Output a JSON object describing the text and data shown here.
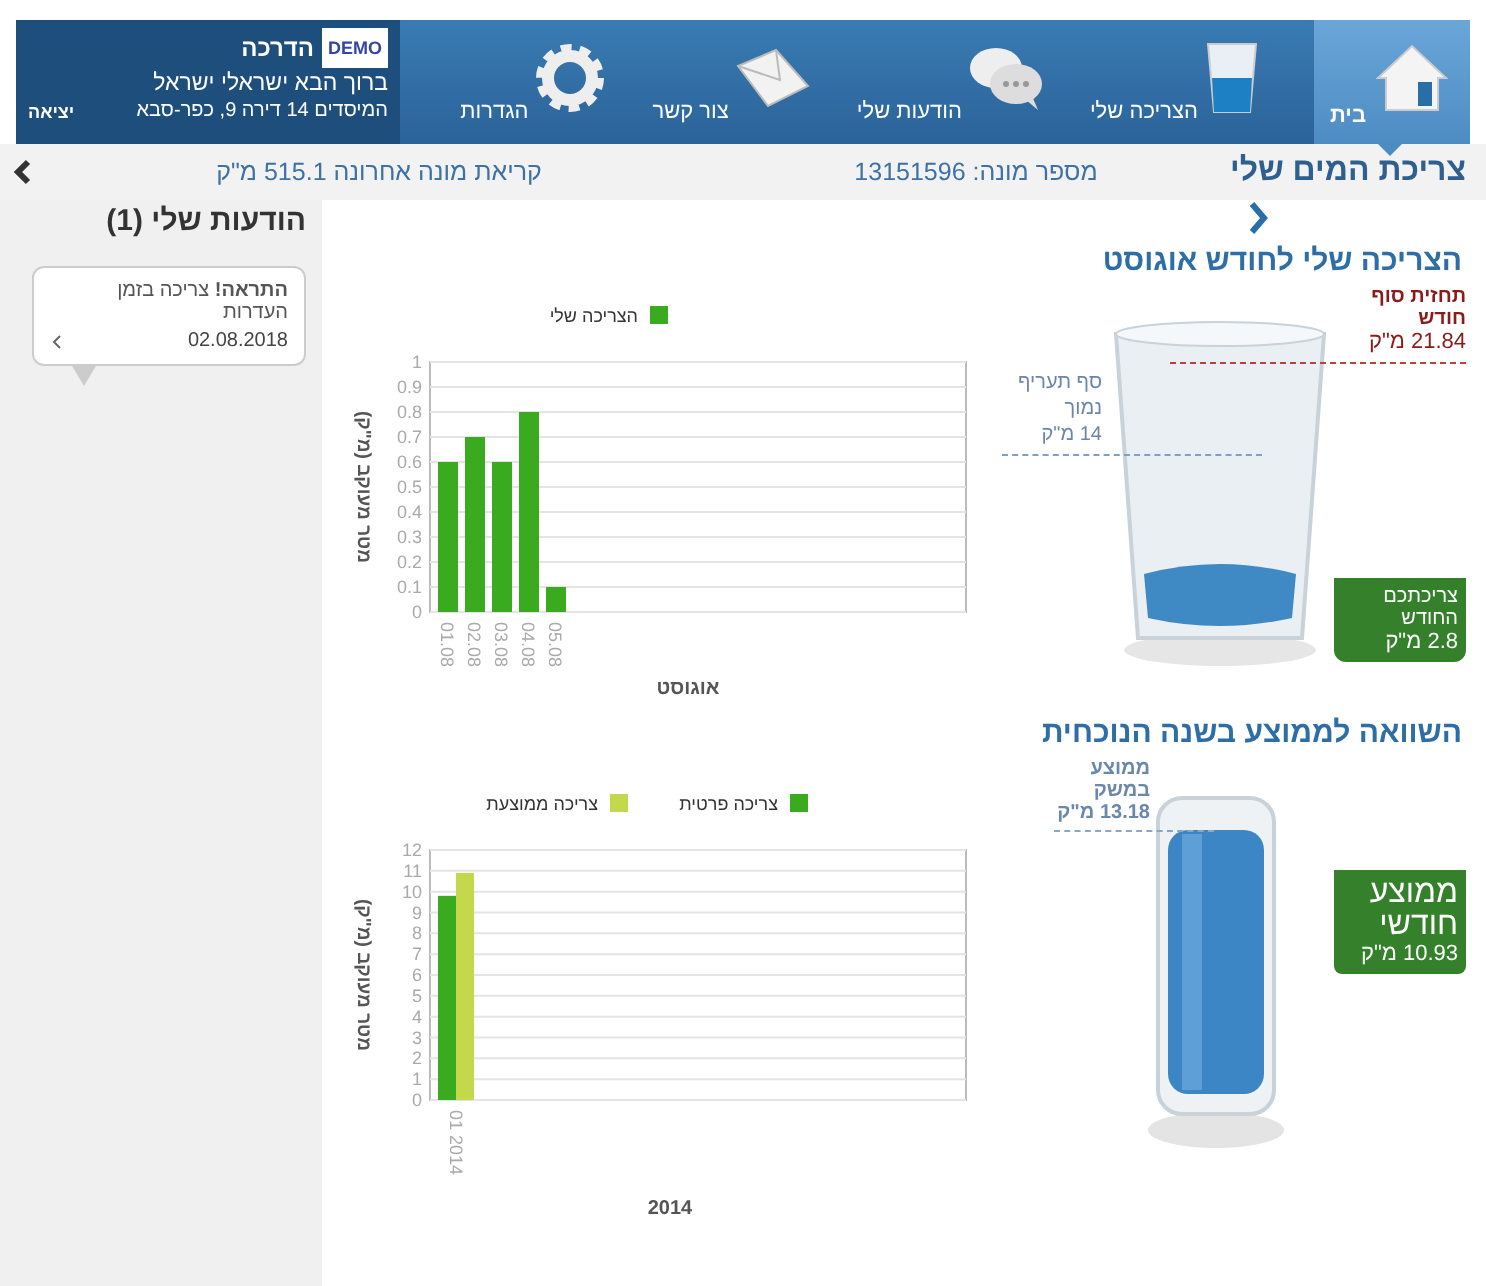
{
  "header": {
    "user": {
      "demo_badge": "DEMO",
      "guide": "הדרכה",
      "greeting": "ברוך הבא ישראלי ישראל",
      "address": "המיסדים 14 דירה 9, כפר-סבא",
      "logout": "יציאה"
    },
    "nav": [
      {
        "label": "בית",
        "kind": "home",
        "selected": true
      },
      {
        "label": "הצריכה שלי",
        "kind": "glass",
        "selected": false
      },
      {
        "label": "הודעות שלי",
        "kind": "chat",
        "selected": false
      },
      {
        "label": "צור קשר",
        "kind": "mail",
        "selected": false
      },
      {
        "label": "הגדרות",
        "kind": "gear",
        "selected": false
      }
    ]
  },
  "subheader": {
    "title": "צריכת המים שלי",
    "meter": "מספר מונה: 13151596",
    "last_reading": "קריאת מונה אחרונה 515.1 מ\"ק"
  },
  "sidebar": {
    "title": "הודעות שלי (1)",
    "messages": [
      {
        "text": "**התראה!** צריכה בזמן העדרות",
        "date": "02.08.2018"
      }
    ]
  },
  "monthly": {
    "title": "הצריכה שלי לחודש אוגוסט",
    "forecast_label": "תחזית סוף חודש",
    "forecast_value": "21.84 מ\"ק",
    "tier_label": "סף תעריף נמוך",
    "tier_value": "14 מ\"ק",
    "current_label": "צריכתכם החודש",
    "current_value": "2.8 מ\"ק",
    "chart_data": {
      "type": "bar",
      "xlabel": "אוגוסט",
      "ylabel": "מטר מעוקב (מ\"ק)",
      "categories": [
        "01.08",
        "02.08",
        "03.08",
        "04.08",
        "05.08"
      ],
      "series": [
        {
          "name": "הצריכה שלי",
          "color": "#3aab1e",
          "values": [
            0.6,
            0.7,
            0.6,
            0.8,
            0.1
          ]
        }
      ],
      "yticks": [
        0,
        0.1,
        0.2,
        0.3,
        0.4,
        0.5,
        0.6,
        0.7,
        0.8,
        0.9,
        1
      ],
      "ylim": [
        0,
        1
      ],
      "grid": true,
      "legend": true
    }
  },
  "yearly": {
    "title": "השוואה לממוצע בשנה הנוכחית",
    "household_label": "ממוצע במשק",
    "household_value": "13.18 מ\"ק",
    "monthly_label": "ממוצע חודשי",
    "monthly_value": "10.93 מ\"ק",
    "year_caption": "2014",
    "chart_data": {
      "type": "bar",
      "ylabel": "מטר מעוקב (מ\"ק)",
      "categories": [
        "01 2014"
      ],
      "series": [
        {
          "name": "צריכה פרטית",
          "color": "#3aab1e",
          "values": [
            9.8
          ]
        },
        {
          "name": "צריכה ממוצעת",
          "color": "#c3d84a",
          "values": [
            10.9
          ]
        }
      ],
      "yticks": [
        0,
        1,
        2,
        3,
        4,
        5,
        6,
        7,
        8,
        9,
        10,
        11,
        12
      ],
      "ylim": [
        0,
        12
      ],
      "grid": true,
      "legend": true
    }
  }
}
